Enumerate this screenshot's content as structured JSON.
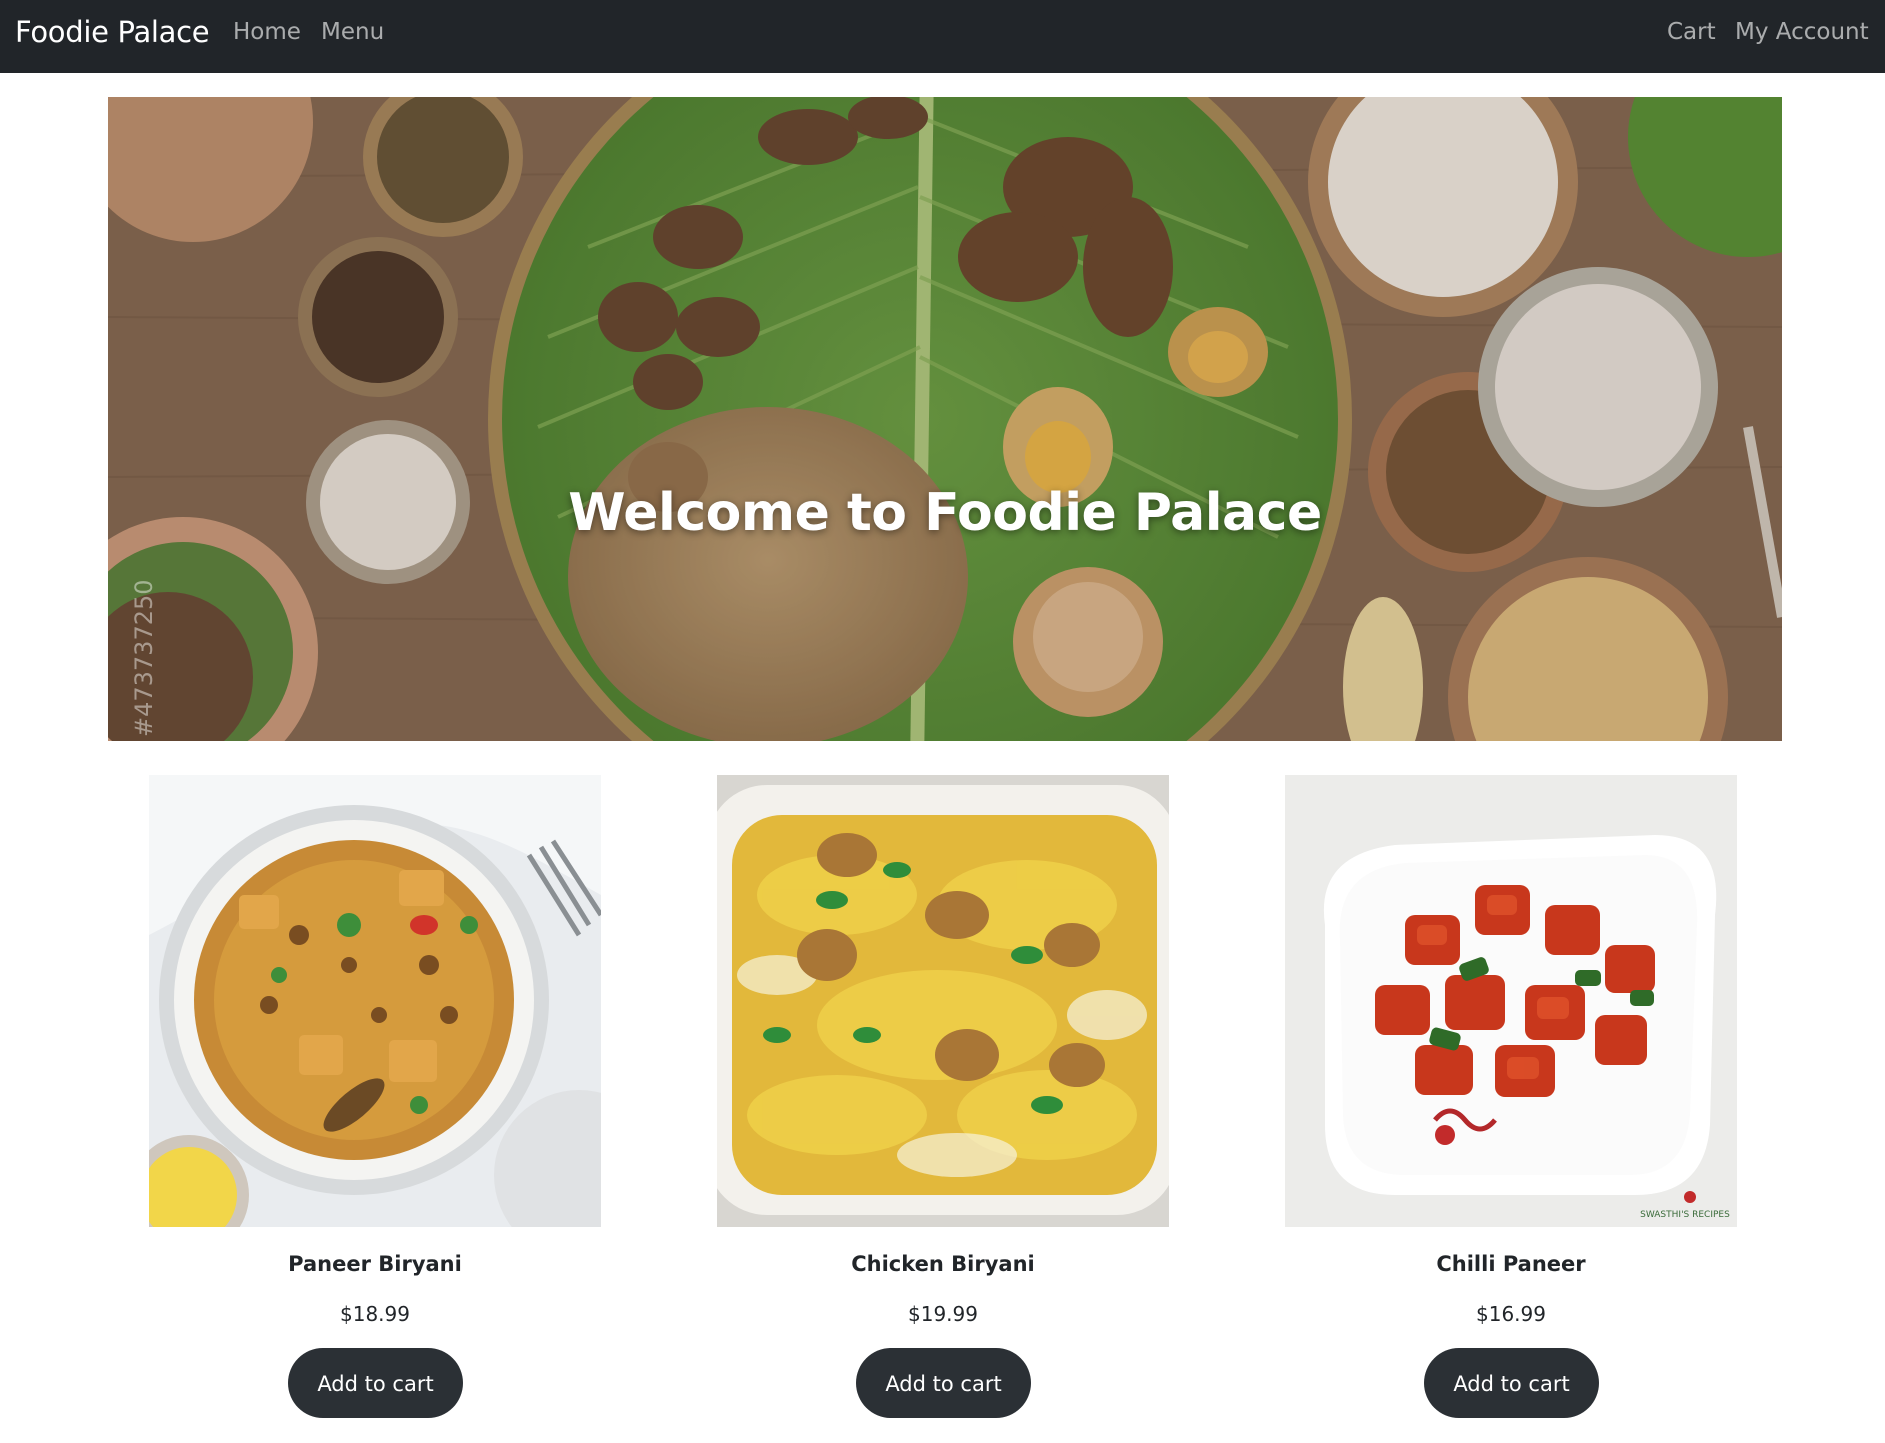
{
  "navbar": {
    "brand": "Foodie Palace",
    "left_links": [
      "Home",
      "Menu"
    ],
    "right_links": [
      "Cart",
      "My Account"
    ]
  },
  "hero": {
    "title": "Welcome to Foodie Palace",
    "watermark": "#473737250"
  },
  "products": [
    {
      "name": "Paneer Biryani",
      "price": "$18.99",
      "button": "Add to cart",
      "image": "paneer-biryani-plate"
    },
    {
      "name": "Chicken Biryani",
      "price": "$19.99",
      "button": "Add to cart",
      "image": "chicken-biryani-platter"
    },
    {
      "name": "Chilli Paneer",
      "price": "$16.99",
      "button": "Add to cart",
      "image": "chilli-paneer-plate",
      "image_badge": "SWASTHI'S RECIPES"
    }
  ],
  "colors": {
    "navbar_bg": "#212529",
    "button_bg": "#2b3035",
    "text": "#212529"
  }
}
